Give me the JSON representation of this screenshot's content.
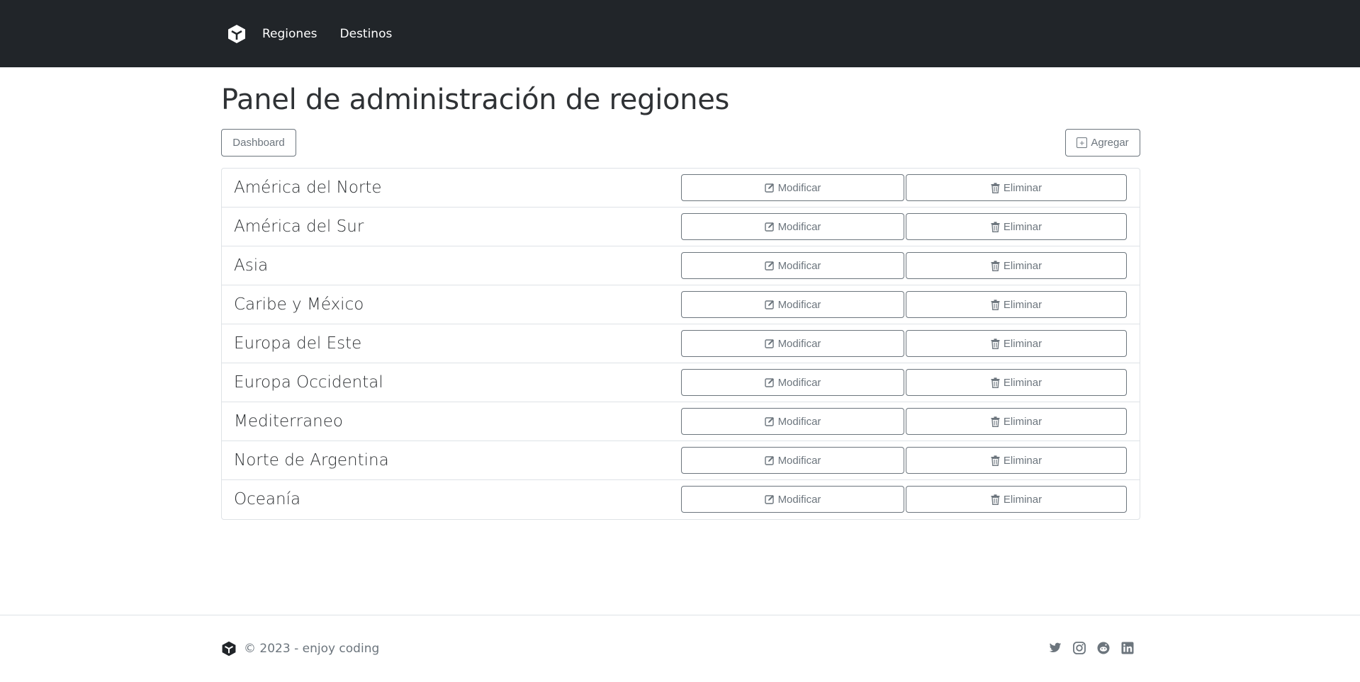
{
  "navbar": {
    "brand_icon": "cube-logo-icon",
    "links": [
      {
        "label": "Regiones"
      },
      {
        "label": "Destinos"
      }
    ]
  },
  "main": {
    "title": "Panel de administración de regiones",
    "dashboard_label": "Dashboard",
    "add_label": "Agregar",
    "modify_label": "Modificar",
    "delete_label": "Eliminar",
    "regions": [
      {
        "name": "América del Norte"
      },
      {
        "name": "América del Sur"
      },
      {
        "name": "Asia"
      },
      {
        "name": "Caribe y México"
      },
      {
        "name": "Europa del Este"
      },
      {
        "name": "Europa Occidental"
      },
      {
        "name": "Mediterraneo"
      },
      {
        "name": "Norte de Argentina"
      },
      {
        "name": "Oceanía"
      }
    ]
  },
  "footer": {
    "copyright": "© 2023 - enjoy coding",
    "socials": [
      "twitter-icon",
      "instagram-icon",
      "reddit-icon",
      "linkedin-icon"
    ]
  },
  "colors": {
    "navbar_bg": "#212529",
    "secondary": "#6c757d",
    "border": "#dee2e6"
  }
}
